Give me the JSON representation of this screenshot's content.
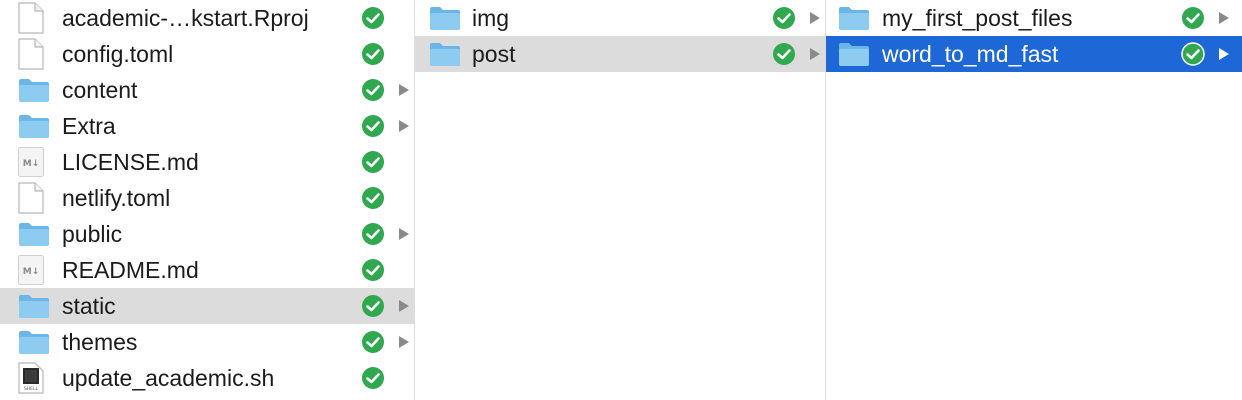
{
  "colors": {
    "folder_light": "#8ecbf0",
    "folder_dark": "#6bb6e6",
    "check_green": "#2fa84f",
    "selection_gray": "#dcdcdc",
    "selection_blue": "#1d67d6"
  },
  "column1": {
    "items": [
      {
        "label": "academic-…kstart.Rproj",
        "icon": "document-icon",
        "synced": true,
        "has_children": false
      },
      {
        "label": "config.toml",
        "icon": "document-icon",
        "synced": true,
        "has_children": false
      },
      {
        "label": "content",
        "icon": "folder-icon",
        "synced": true,
        "has_children": true
      },
      {
        "label": "Extra",
        "icon": "folder-icon",
        "synced": true,
        "has_children": true
      },
      {
        "label": "LICENSE.md",
        "icon": "markdown-file-icon",
        "badge": "M↓",
        "synced": true,
        "has_children": false
      },
      {
        "label": "netlify.toml",
        "icon": "document-icon",
        "synced": true,
        "has_children": false
      },
      {
        "label": "public",
        "icon": "folder-icon",
        "synced": true,
        "has_children": true
      },
      {
        "label": "README.md",
        "icon": "markdown-file-icon",
        "badge": "M↓",
        "synced": true,
        "has_children": false
      },
      {
        "label": "static",
        "icon": "folder-icon",
        "synced": true,
        "has_children": true,
        "selected": "inactive"
      },
      {
        "label": "themes",
        "icon": "folder-icon",
        "synced": true,
        "has_children": true
      },
      {
        "label": "update_academic.sh",
        "icon": "shell-script-icon",
        "badge": "SHELL",
        "synced": true,
        "has_children": false
      }
    ]
  },
  "column2": {
    "items": [
      {
        "label": "img",
        "icon": "folder-icon",
        "synced": true,
        "has_children": true
      },
      {
        "label": "post",
        "icon": "folder-icon",
        "synced": true,
        "has_children": true,
        "selected": "inactive"
      }
    ]
  },
  "column3": {
    "items": [
      {
        "label": "my_first_post_files",
        "icon": "folder-icon",
        "synced": true,
        "has_children": true
      },
      {
        "label": "word_to_md_fast",
        "icon": "folder-icon",
        "synced": true,
        "has_children": true,
        "selected": "active"
      }
    ]
  }
}
